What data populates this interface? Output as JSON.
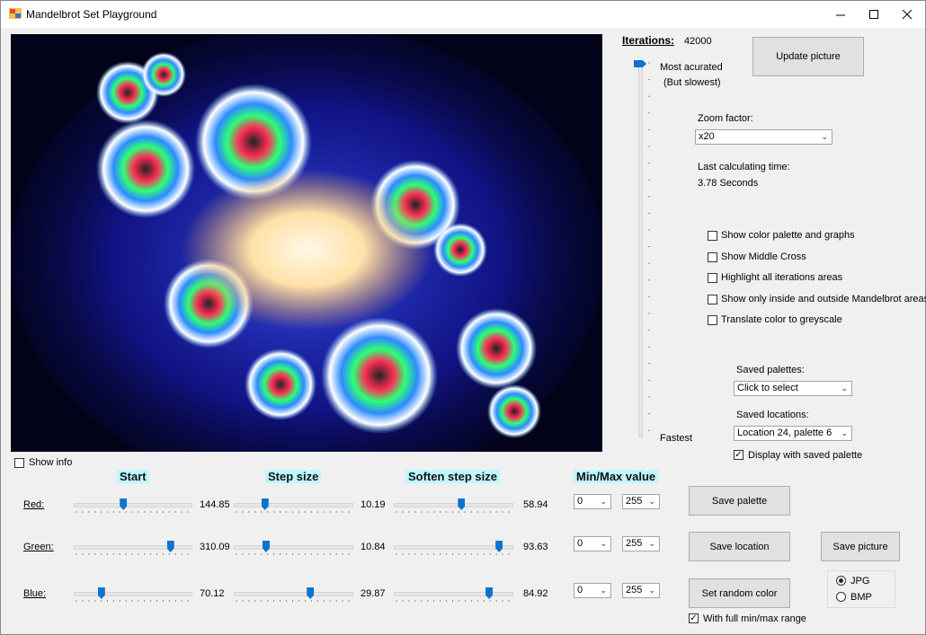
{
  "window": {
    "title": "Mandelbrot Set Playground"
  },
  "iterations": {
    "label": "Iterations:",
    "value": "42000",
    "top_label": "Most acurated",
    "top_sublabel": "(But slowest)",
    "bottom_label": "Fastest",
    "level": 1.0
  },
  "buttons": {
    "update": "Update picture",
    "save_palette": "Save  palette",
    "save_location": "Save location",
    "save_picture": "Save picture",
    "random_color": "Set random color"
  },
  "zoom": {
    "label": "Zoom factor:",
    "value": "x20"
  },
  "calc": {
    "label": "Last calculating time:",
    "value": "3.78 Seconds"
  },
  "options": [
    {
      "label": "Show color palette and graphs",
      "checked": false
    },
    {
      "label": "Show Middle Cross",
      "checked": false
    },
    {
      "label": "Highlight all iterations areas",
      "checked": false
    },
    {
      "label": "Show only inside and outside Mandelbrot areas",
      "checked": false
    },
    {
      "label": "Translate color to greyscale",
      "checked": false
    }
  ],
  "saved_palettes": {
    "label": "Saved palettes:",
    "value": "Click to select"
  },
  "saved_locations": {
    "label": "Saved locations:",
    "value": "Location 24, palette 6"
  },
  "display_saved": {
    "label": "Display with saved palette",
    "checked": true
  },
  "show_info": {
    "label": "Show info",
    "checked": false
  },
  "headers": {
    "start": "Start",
    "step": "Step size",
    "soften": "Soften step size",
    "minmax": "Min/Max value"
  },
  "channels": [
    {
      "name": "Red:",
      "start": "144.85",
      "start_pos": 0.42,
      "step": "10.19",
      "step_pos": 0.25,
      "soften": "58.94",
      "soften_pos": 0.58,
      "min": "0",
      "max": "255"
    },
    {
      "name": "Green:",
      "start": "310.09",
      "start_pos": 0.85,
      "step": "10.84",
      "step_pos": 0.26,
      "soften": "93.63",
      "soften_pos": 0.92,
      "min": "0",
      "max": "255"
    },
    {
      "name": "Blue:",
      "start": "70.12",
      "start_pos": 0.22,
      "step": "29.87",
      "step_pos": 0.66,
      "soften": "84.92",
      "soften_pos": 0.83,
      "min": "0",
      "max": "255"
    }
  ],
  "full_range": {
    "label": "With full min/max range",
    "checked": true
  },
  "format": {
    "options": [
      "JPG",
      "BMP"
    ],
    "selected": "JPG"
  },
  "colors": {
    "accent": "#0a74d0",
    "header_bg": "#bdf7fd",
    "canvas_bg": "#020218"
  }
}
